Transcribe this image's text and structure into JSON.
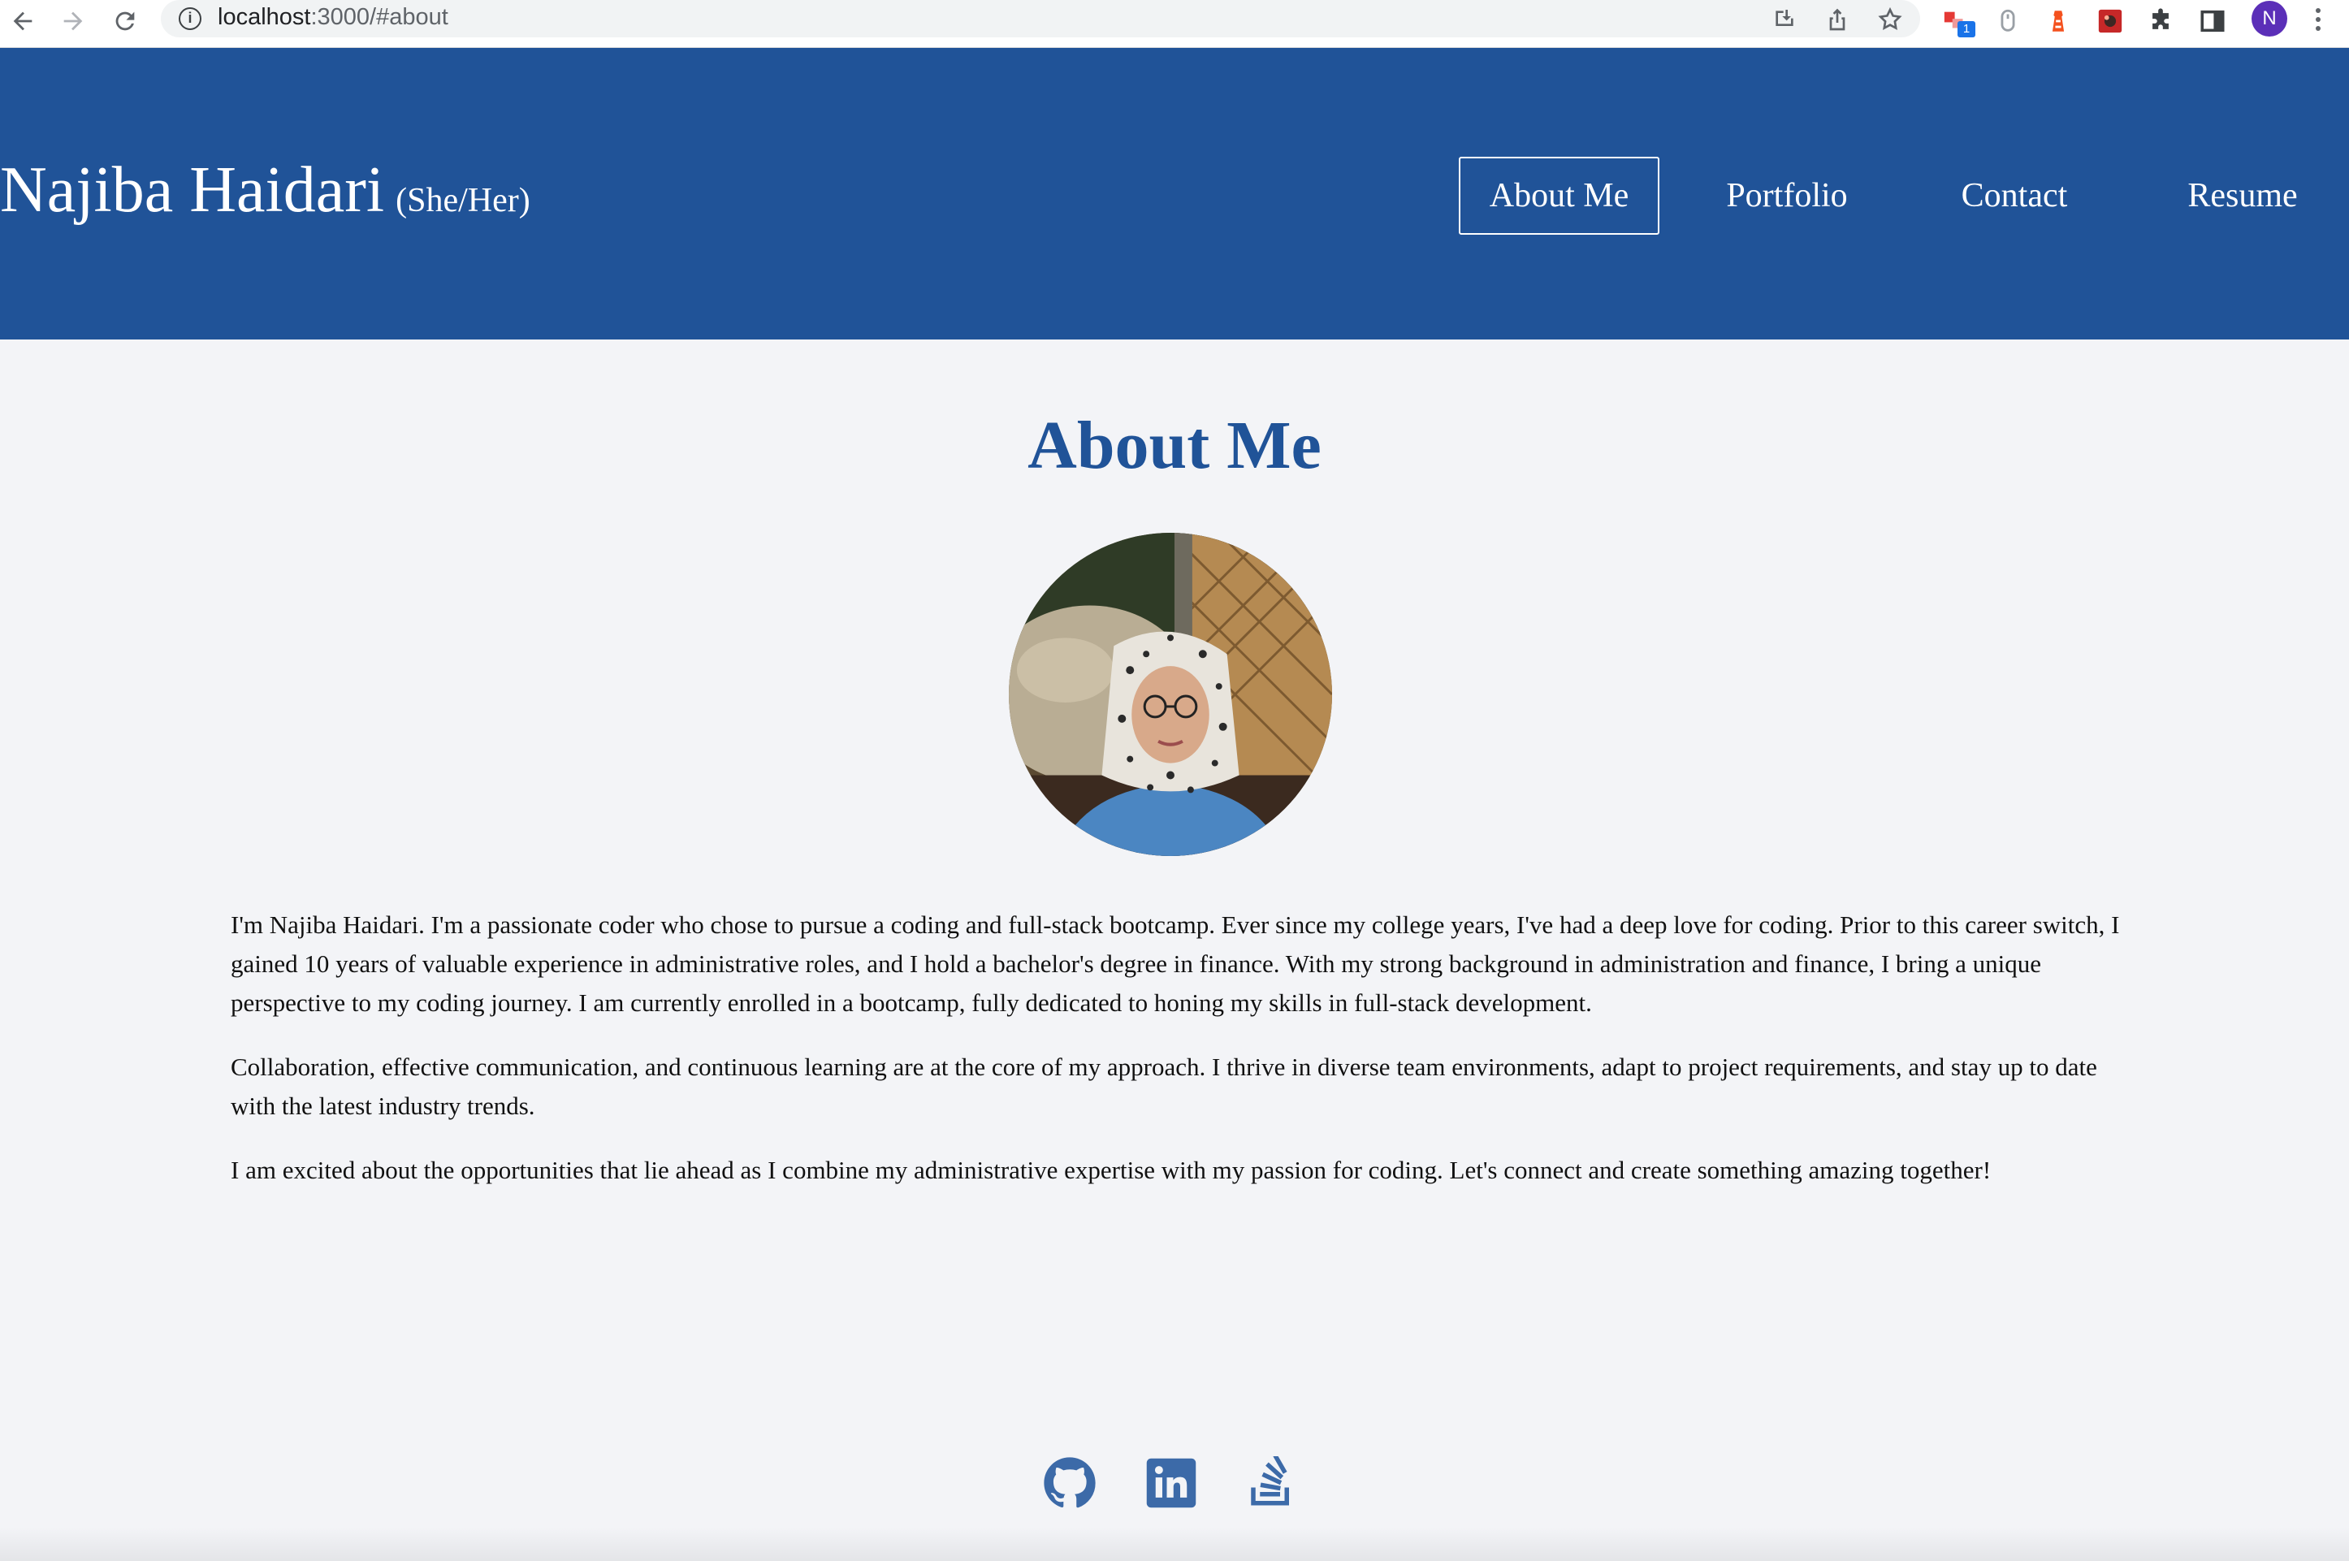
{
  "browser": {
    "url_host": "localhost",
    "url_path": ":3000/#about",
    "profile_initial": "N",
    "extension_badge": "1"
  },
  "header": {
    "name": "Najiba Haidari",
    "pronouns": "(She/Her)",
    "nav": [
      {
        "label": "About Me",
        "active": true
      },
      {
        "label": "Portfolio",
        "active": false
      },
      {
        "label": "Contact",
        "active": false
      },
      {
        "label": "Resume",
        "active": false
      }
    ]
  },
  "about": {
    "heading": "About Me",
    "paragraphs": [
      "I'm Najiba Haidari. I'm a passionate coder who chose to pursue a coding and full-stack bootcamp. Ever since my college years, I've had a deep love for coding. Prior to this career switch, I gained 10 years of valuable experience in administrative roles, and I hold a bachelor's degree in finance. With my strong background in administration and finance, I bring a unique perspective to my coding journey. I am currently enrolled in a bootcamp, fully dedicated to honing my skills in full-stack development.",
      "Collaboration, effective communication, and continuous learning are at the core of my approach. I thrive in diverse team environments, adapt to project requirements, and stay up to date with the latest industry trends.",
      "I am excited about the opportunities that lie ahead as I combine my administrative expertise with my passion for coding. Let's connect and create something amazing together!"
    ]
  },
  "footer": {
    "icons": [
      "github-icon",
      "linkedin-icon",
      "stackoverflow-icon"
    ]
  },
  "colors": {
    "brand_blue": "#205398",
    "background": "#f3f4f7",
    "icon_blue": "#3c6aa8"
  }
}
